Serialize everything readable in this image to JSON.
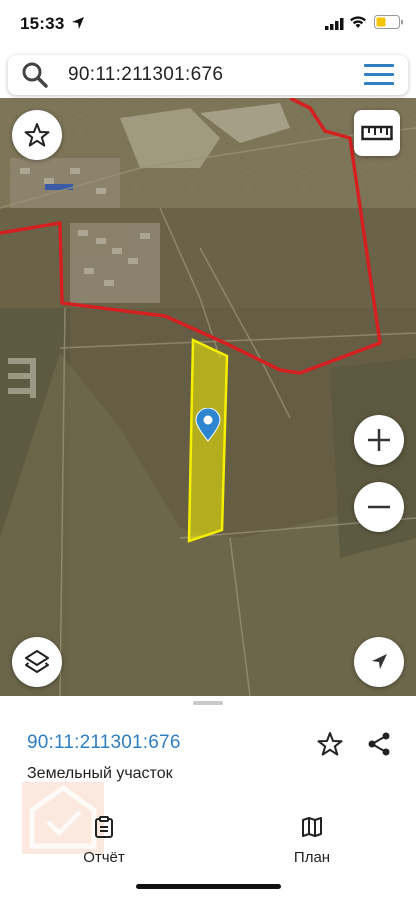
{
  "status_bar": {
    "time": "15:33"
  },
  "search": {
    "query": "90:11:211301:676"
  },
  "map": {
    "parcel_color": "#f5f000",
    "boundary_color": "#d42020",
    "buttons": {
      "favorite": "star-icon",
      "ruler": "ruler-icon",
      "zoom_in": "plus-icon",
      "zoom_out": "minus-icon",
      "layers": "layers-icon",
      "locate": "navigation-arrow-icon"
    }
  },
  "sheet": {
    "cadastral_number": "90:11:211301:676",
    "object_type": "Земельный участок",
    "tabs": [
      {
        "label": "Отчёт",
        "icon": "clipboard-icon"
      },
      {
        "label": "План",
        "icon": "map-icon"
      }
    ]
  }
}
